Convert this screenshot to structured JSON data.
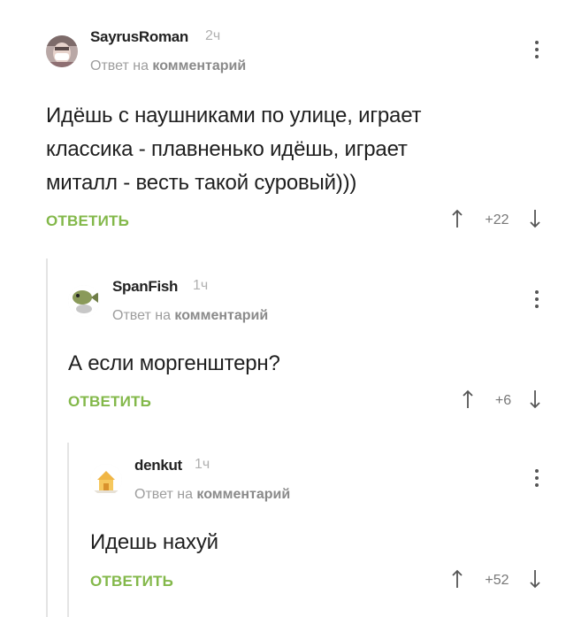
{
  "comments": [
    {
      "author": "SayrusRoman",
      "time": "2ч",
      "reply_prefix": "Ответ на",
      "reply_target": "комментарий",
      "text_lines": [
        "Идёшь с наушниками по улице, играет",
        "классика - плавненько идёшь, играет",
        "миталл - весть такой суровый)))"
      ],
      "reply_label": "ОТВЕТИТЬ",
      "score": "+22",
      "avatar_icon": "person-with-mask-avatar"
    },
    {
      "author": "SpanFish",
      "time": "1ч",
      "reply_prefix": "Ответ на",
      "reply_target": "комментарий",
      "text_lines": [
        "А если моргенштерн?"
      ],
      "reply_label": "ОТВЕТИТЬ",
      "score": "+6",
      "avatar_icon": "cartoon-fish-avatar"
    },
    {
      "author": "denkut",
      "time": "1ч",
      "reply_prefix": "Ответ на",
      "reply_target": "комментарий",
      "text_lines": [
        "Идешь нахуй"
      ],
      "reply_label": "ОТВЕТИТЬ",
      "score": "+52",
      "avatar_icon": "yellow-house-avatar"
    }
  ],
  "colors": {
    "reply_green": "#83b84a",
    "thread_line": "#e4e4e4"
  }
}
